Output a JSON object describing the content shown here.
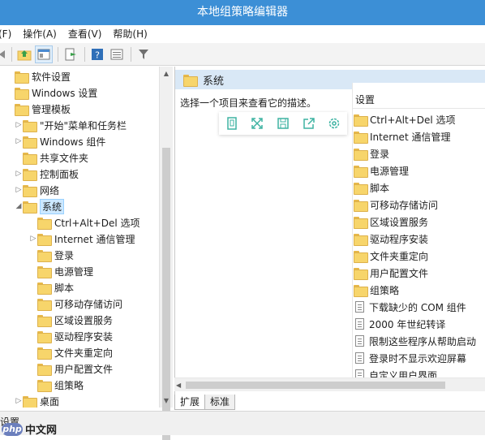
{
  "window": {
    "title": "本地组策略编辑器"
  },
  "menu": [
    "(F)",
    "操作(A)",
    "查看(V)",
    "帮助(H)"
  ],
  "toolbar": {
    "icons": [
      "back-icon",
      "folder-up-icon",
      "show-hide-tree-icon",
      "export-list-icon",
      "help-icon",
      "properties-icon",
      "filter-icon"
    ]
  },
  "tree": {
    "items": [
      {
        "label": "软件设置",
        "level": 0,
        "expander": ""
      },
      {
        "label": "Windows 设置",
        "level": 0,
        "expander": ""
      },
      {
        "label": "管理模板",
        "level": 0,
        "expander": ""
      },
      {
        "label": "\"开始\"菜单和任务栏",
        "level": 1,
        "expander": "▷"
      },
      {
        "label": "Windows 组件",
        "level": 1,
        "expander": "▷"
      },
      {
        "label": "共享文件夹",
        "level": 1,
        "expander": ""
      },
      {
        "label": "控制面板",
        "level": 1,
        "expander": "▷"
      },
      {
        "label": "网络",
        "level": 1,
        "expander": "▷"
      },
      {
        "label": "系统",
        "level": 1,
        "expander": "◢",
        "selected": true
      },
      {
        "label": "Ctrl+Alt+Del 选项",
        "level": 2,
        "expander": ""
      },
      {
        "label": "Internet 通信管理",
        "level": 2,
        "expander": "▷"
      },
      {
        "label": "登录",
        "level": 2,
        "expander": ""
      },
      {
        "label": "电源管理",
        "level": 2,
        "expander": ""
      },
      {
        "label": "脚本",
        "level": 2,
        "expander": ""
      },
      {
        "label": "可移动存储访问",
        "level": 2,
        "expander": ""
      },
      {
        "label": "区域设置服务",
        "level": 2,
        "expander": ""
      },
      {
        "label": "驱动程序安装",
        "level": 2,
        "expander": ""
      },
      {
        "label": "文件夹重定向",
        "level": 2,
        "expander": ""
      },
      {
        "label": "用户配置文件",
        "level": 2,
        "expander": ""
      },
      {
        "label": "组策略",
        "level": 2,
        "expander": ""
      },
      {
        "label": "桌面",
        "level": 1,
        "expander": "▷"
      }
    ]
  },
  "details": {
    "header_title": "系统",
    "description": "选择一个项目来查看它的描述。",
    "column_header": "设置",
    "items": [
      {
        "label": "Ctrl+Alt+Del 选项",
        "type": "folder"
      },
      {
        "label": "Internet 通信管理",
        "type": "folder"
      },
      {
        "label": "登录",
        "type": "folder"
      },
      {
        "label": "电源管理",
        "type": "folder"
      },
      {
        "label": "脚本",
        "type": "folder"
      },
      {
        "label": "可移动存储访问",
        "type": "folder"
      },
      {
        "label": "区域设置服务",
        "type": "folder"
      },
      {
        "label": "驱动程序安装",
        "type": "folder"
      },
      {
        "label": "文件夹重定向",
        "type": "folder"
      },
      {
        "label": "用户配置文件",
        "type": "folder"
      },
      {
        "label": "组策略",
        "type": "folder"
      },
      {
        "label": "下载缺少的 COM 组件",
        "type": "setting"
      },
      {
        "label": "2000 年世纪转译",
        "type": "setting"
      },
      {
        "label": "限制这些程序从帮助启动",
        "type": "setting"
      },
      {
        "label": "登录时不显示欢迎屏幕",
        "type": "setting"
      },
      {
        "label": "自定义用户界面",
        "type": "setting"
      }
    ],
    "action_icons": [
      "copy-icon",
      "fullscreen-icon",
      "save-icon",
      "share-icon",
      "settings-icon"
    ]
  },
  "tabs": [
    "扩展",
    "标准"
  ],
  "status": {
    "text": "设置"
  },
  "watermark": {
    "badge": "php",
    "text": "中文网"
  }
}
